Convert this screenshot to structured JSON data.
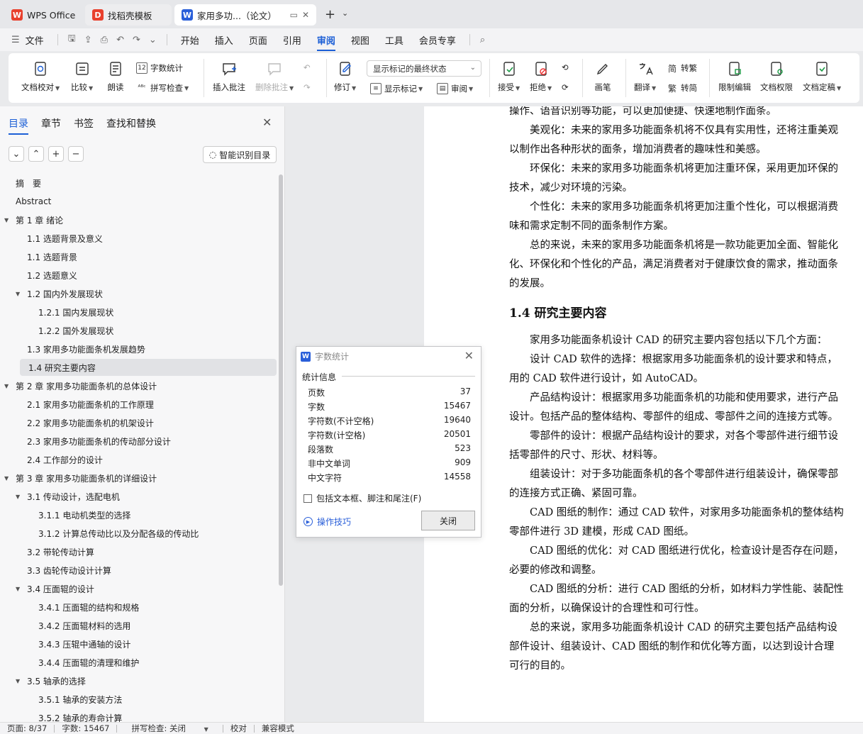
{
  "tabs": [
    {
      "label": "WPS Office",
      "color": "#e8402d"
    },
    {
      "label": "找稻壳模板",
      "color": "#e8402d"
    },
    {
      "label": "家用多功...（论文）",
      "color": "#2a5fd9"
    }
  ],
  "menu": {
    "file": "文件",
    "items": [
      "开始",
      "插入",
      "页面",
      "引用",
      "审阅",
      "视图",
      "工具",
      "会员专享"
    ],
    "active": "审阅"
  },
  "ribbon": {
    "doc_check": "文档校对",
    "compare": "比较",
    "read": "朗读",
    "word_count": "字数统计",
    "spell_check": "拼写检查",
    "insert_comment": "插入批注",
    "delete_comment": "删除批注",
    "revise": "修订",
    "display_dropdown": "显示标记的最终状态",
    "show_marks": "显示标记",
    "review": "审阅",
    "accept": "接受",
    "reject": "拒绝",
    "ink": "画笔",
    "translate": "翻译",
    "to_trad": "转繁",
    "to_simp": "转简",
    "restrict_edit": "限制编辑",
    "doc_perm": "文档权限",
    "doc_final": "文档定稿"
  },
  "sidebar": {
    "tabs": [
      "目录",
      "章节",
      "书签",
      "查找和替换"
    ],
    "smart_button": "智能识别目录",
    "toc": [
      {
        "text": "摘　要",
        "level": 1,
        "tw": false
      },
      {
        "text": "Abstract",
        "level": 1,
        "tw": false
      },
      {
        "text": "第 1 章  绪论",
        "level": 1,
        "tw": true
      },
      {
        "text": "1.1 选题背景及意义",
        "level": 2,
        "tw": false
      },
      {
        "text": "1.1 选题背景",
        "level": 2,
        "tw": false
      },
      {
        "text": "1.2 选题意义",
        "level": 2,
        "tw": false
      },
      {
        "text": "1.2 国内外发展现状",
        "level": 2,
        "tw": true
      },
      {
        "text": "1.2.1 国内发展现状",
        "level": 3,
        "tw": false
      },
      {
        "text": "1.2.2 国外发展现状",
        "level": 3,
        "tw": false
      },
      {
        "text": "1.3 家用多功能面条机发展趋势",
        "level": 2,
        "tw": false
      },
      {
        "text": "1.4 研究主要内容",
        "level": 2,
        "tw": false,
        "selected": true
      },
      {
        "text": "第 2 章  家用多功能面条机的总体设计",
        "level": 1,
        "tw": true
      },
      {
        "text": "2.1 家用多功能面条机的工作原理",
        "level": 2,
        "tw": false
      },
      {
        "text": "2.2 家用多功能面条机的机架设计",
        "level": 2,
        "tw": false
      },
      {
        "text": "2.3 家用多功能面条机的传动部分设计",
        "level": 2,
        "tw": false
      },
      {
        "text": "2.4 工作部分的设计",
        "level": 2,
        "tw": false
      },
      {
        "text": "第 3 章  家用多功能面条机的详细设计",
        "level": 1,
        "tw": true
      },
      {
        "text": "3.1 传动设计，选配电机",
        "level": 2,
        "tw": true
      },
      {
        "text": "3.1.1  电动机类型的选择",
        "level": 3,
        "tw": false
      },
      {
        "text": "3.1.2  计算总传动比以及分配各级的传动比",
        "level": 3,
        "tw": false
      },
      {
        "text": "3.2  带轮传动计算",
        "level": 2,
        "tw": false
      },
      {
        "text": "3.3  齿轮传动设计计算",
        "level": 2,
        "tw": false
      },
      {
        "text": "3.4  压面辊的设计",
        "level": 2,
        "tw": true
      },
      {
        "text": "3.4.1  压面辊的结构和规格",
        "level": 3,
        "tw": false
      },
      {
        "text": "3.4.2  压面辊材料的选用",
        "level": 3,
        "tw": false
      },
      {
        "text": "3.4.3  压辊中通轴的设计",
        "level": 3,
        "tw": false
      },
      {
        "text": "3.4.4  压面辊的清理和维护",
        "level": 3,
        "tw": false
      },
      {
        "text": "3.5  轴承的选择",
        "level": 2,
        "tw": true
      },
      {
        "text": "3.5.1 轴承的安装方法",
        "level": 3,
        "tw": false
      },
      {
        "text": "3.5.2 轴承的寿命计算",
        "level": 3,
        "tw": false
      }
    ]
  },
  "document": {
    "heading_marker": "H₂",
    "heading": "1.4 研究主要内容",
    "lines_before": [
      "操作、语音识别等功能，可以更加便捷、快速地制作面条。",
      "　　美观化：未来的家用多功能面条机将不仅具有实用性，还将注重美观",
      "以制作出各种形状的面条，增加消费者的趣味性和美感。",
      "　　环保化：未来的家用多功能面条机将更加注重环保，采用更加环保的",
      "技术，减少对环境的污染。",
      "　　个性化：未来的家用多功能面条机将更加注重个性化，可以根据消费",
      "味和需求定制不同的面条制作方案。",
      "　　总的来说，未来的家用多功能面条机将是一款功能更加全面、智能化",
      "化、环保化和个性化的产品，满足消费者对于健康饮食的需求，推动面条",
      "的发展。"
    ],
    "lines_after": [
      "　　家用多功能面条机设计 CAD 的研究主要内容包括以下几个方面：",
      "　　设计 CAD 软件的选择：根据家用多功能面条机的设计要求和特点，",
      "用的 CAD 软件进行设计，如 AutoCAD。",
      "　　产品结构设计：根据家用多功能面条机的功能和使用要求，进行产品",
      "设计。包括产品的整体结构、零部件的组成、零部件之间的连接方式等。",
      "　　零部件的设计：根据产品结构设计的要求，对各个零部件进行细节设",
      "括零部件的尺寸、形状、材料等。",
      "　　组装设计：对于多功能面条机的各个零部件进行组装设计，确保零部",
      "的连接方式正确、紧固可靠。",
      "　　CAD 图纸的制作：通过 CAD 软件，对家用多功能面条机的整体结构",
      "零部件进行 3D 建模，形成 CAD 图纸。",
      "　　CAD 图纸的优化：对 CAD 图纸进行优化，检查设计是否存在问题，",
      "必要的修改和调整。",
      "　　CAD 图纸的分析：进行 CAD 图纸的分析，如材料力学性能、装配性",
      "面的分析，以确保设计的合理性和可行性。",
      "　　总的来说，家用多功能面条机设计 CAD 的研究主要包括产品结构设",
      "部件设计、组装设计、CAD 图纸的制作和优化等方面，以达到设计合理",
      "可行的目的。"
    ]
  },
  "dialog": {
    "title": "字数统计",
    "group": "统计信息",
    "rows": [
      {
        "label": "页数",
        "value": "37"
      },
      {
        "label": "字数",
        "value": "15467"
      },
      {
        "label": "字符数(不计空格)",
        "value": "19640"
      },
      {
        "label": "字符数(计空格)",
        "value": "20501"
      },
      {
        "label": "段落数",
        "value": "523"
      },
      {
        "label": "非中文单词",
        "value": "909"
      },
      {
        "label": "中文字符",
        "value": "14558"
      }
    ],
    "checkbox": "包括文本框、脚注和尾注(F)",
    "tips": "操作技巧",
    "close": "关闭"
  },
  "status": {
    "page": "页面: 8/37",
    "words": "字数: 15467",
    "spell": "拼写检查: 关闭",
    "proof": "校对",
    "compat": "兼容模式"
  }
}
